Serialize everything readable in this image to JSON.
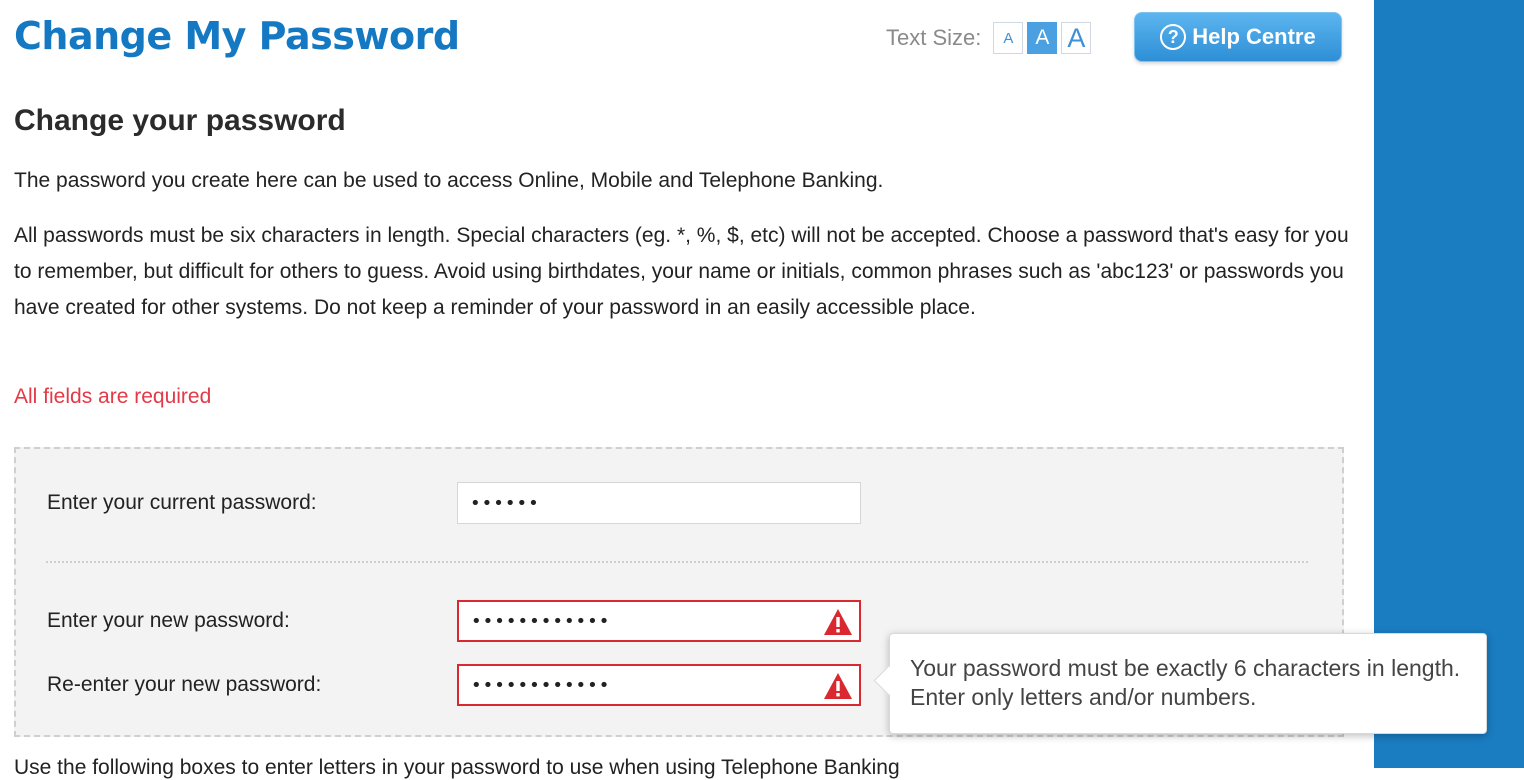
{
  "header": {
    "title": "Change My Password",
    "text_size_label": "Text Size:",
    "text_size_options": [
      "A",
      "A",
      "A"
    ],
    "help_label": "Help Centre",
    "help_icon": "?"
  },
  "main": {
    "heading": "Change your password",
    "intro": "The password you create here can be used to access Online, Mobile and Telephone Banking.",
    "rules": "All passwords must be six characters in length. Special characters (eg. *, %, $, etc) will not be accepted. Choose a password that's easy for you to remember, but difficult for others to guess. Avoid using birthdates, your name or initials, common phrases such as 'abc123' or passwords you have created for other systems. Do not keep a reminder of your password in an easily accessible place.",
    "required_note": "All fields are required",
    "bottom_text": "Use the following boxes to enter letters in your password to use when using Telephone Banking"
  },
  "form": {
    "current_label": "Enter your current password:",
    "current_value": "••••••",
    "new_label": "Enter your new password:",
    "new_value": "••••••••••••",
    "confirm_label": "Re-enter your new password:",
    "confirm_value": "••••••••••••"
  },
  "tooltip": {
    "message": "Your password must be exactly 6 characters in length. Enter only letters and/or numbers."
  },
  "colors": {
    "brand_blue": "#1478c2",
    "side_strip": "#1a7cc1",
    "error_red": "#d9282f",
    "required_red": "#e23a47"
  }
}
